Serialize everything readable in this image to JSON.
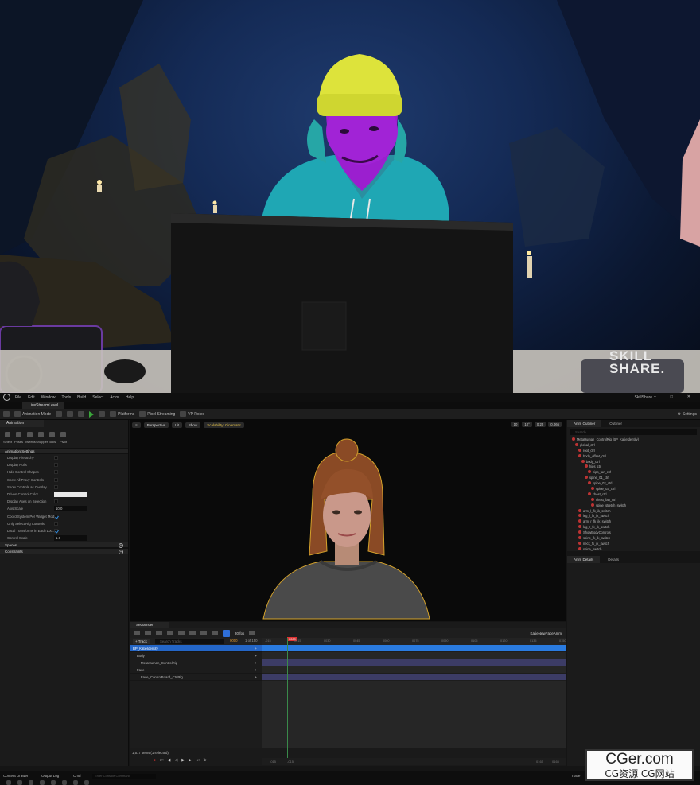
{
  "watermark_top": {
    "line1": "SKILL",
    "line2": "SHARE."
  },
  "editor": {
    "menu": [
      "File",
      "Edit",
      "Window",
      "Tools",
      "Build",
      "Select",
      "Actor",
      "Help"
    ],
    "project_name": "SkillShare",
    "level_tab": "LiveStreamLevel",
    "toolbar": {
      "mode": "Animation Mode",
      "platforms": "Platforms",
      "pixel_streaming": "Pixel Streaming",
      "vp_roles": "VP Roles",
      "settings": "Settings"
    },
    "left_panel": {
      "tab": "Animation",
      "tools": [
        "Select",
        "Poses",
        "Tweens",
        "Snapper",
        "Tools",
        "Pivot"
      ],
      "section_title": "Animation Settings",
      "rows": [
        {
          "label": "Display Hierarchy",
          "type": "check",
          "checked": false
        },
        {
          "label": "Display Nulls",
          "type": "check",
          "checked": false
        },
        {
          "label": "Hide Control Shapes",
          "type": "check",
          "checked": false
        },
        {
          "label": "Show All Proxy Controls",
          "type": "check",
          "checked": false
        },
        {
          "label": "Show Controls as Overlay",
          "type": "check",
          "checked": false
        },
        {
          "label": "Driven Control Color",
          "type": "color"
        },
        {
          "label": "Display Axes on Selection",
          "type": "check",
          "checked": false
        },
        {
          "label": "Axis Scale",
          "type": "value",
          "value": "10.0"
        },
        {
          "label": "Coord System Per Widget Mode",
          "type": "check",
          "checked": true
        },
        {
          "label": "Only Select Rig Controls",
          "type": "check",
          "checked": false
        },
        {
          "label": "Local Transforms in Each Loc...",
          "type": "check",
          "checked": true
        },
        {
          "label": "Control Scale",
          "type": "value",
          "value": "1.0"
        }
      ],
      "sections_after": [
        "Spaces",
        "Constraints"
      ]
    },
    "viewport": {
      "view_mode": "Perspective",
      "lit": "Lit",
      "show": "Show",
      "scalability": "Scalability: Cinematic",
      "right": [
        "10",
        "10°",
        "0.25",
        "0.066"
      ]
    },
    "sequencer": {
      "tab": "Sequencer",
      "fps": "30 fps",
      "sequence_name": "KatieNewFaceAnim",
      "track_button": "+ Track",
      "search_placeholder": "Search Tracks",
      "frame": "0000",
      "frame_count": "1 of 150",
      "playhead": "0000",
      "ticks": [
        "-015",
        "0015",
        "0030",
        "0045",
        "0060",
        "0075",
        "0090",
        "0105",
        "0120",
        "0135",
        "0150"
      ],
      "tracks": [
        {
          "label": "BP_KatieIdentity",
          "indent": 0,
          "selected": true
        },
        {
          "label": "Body",
          "indent": 1,
          "selected": false
        },
        {
          "label": "MetaHuman_ControlRig",
          "indent": 2,
          "selected": false
        },
        {
          "label": "Face",
          "indent": 1,
          "selected": false
        },
        {
          "label": "Face_ControlBoard_CtrlRig",
          "indent": 2,
          "selected": false
        }
      ],
      "status": "1,517 items (1 selected)",
      "foot_left": [
        "-015",
        "-015"
      ],
      "foot_right": [
        "0165",
        "0165"
      ]
    },
    "outliner": {
      "tabs": [
        "Anim Outliner",
        "Outliner"
      ],
      "search_placeholder": "Search...",
      "nodes": [
        {
          "label": "MetaHuman_ControlRig (BP_KatieIdentity)",
          "indent": 0
        },
        {
          "label": "global_ctrl",
          "indent": 1
        },
        {
          "label": "root_ctrl",
          "indent": 2
        },
        {
          "label": "body_offset_ctrl",
          "indent": 2
        },
        {
          "label": "body_ctrl",
          "indent": 3
        },
        {
          "label": "hips_ctrl",
          "indent": 4
        },
        {
          "label": "hips_fan_ctrl",
          "indent": 5
        },
        {
          "label": "spine_01_ctrl",
          "indent": 4
        },
        {
          "label": "spine_02_ctrl",
          "indent": 5
        },
        {
          "label": "spine_03_ctrl",
          "indent": 6
        },
        {
          "label": "chest_ctrl",
          "indent": 5
        },
        {
          "label": "chest_fan_ctrl",
          "indent": 6
        },
        {
          "label": "spine_stretch_switch",
          "indent": 6
        },
        {
          "label": "arm_l_fk_ik_switch",
          "indent": 2
        },
        {
          "label": "leg_l_fk_ik_switch",
          "indent": 2
        },
        {
          "label": "arm_r_fk_ik_switch",
          "indent": 2
        },
        {
          "label": "leg_r_fk_ik_switch",
          "indent": 2
        },
        {
          "label": "ShowBodyControls",
          "indent": 2
        },
        {
          "label": "spine_fk_ik_switch",
          "indent": 2
        },
        {
          "label": "neck_fk_ik_switch",
          "indent": 2
        },
        {
          "label": "spine_switch",
          "indent": 2
        }
      ]
    },
    "details": {
      "tabs": [
        "Anim Details",
        "Details"
      ]
    },
    "bottom": {
      "content_drawer": "Content Drawer",
      "output_log": "Output Log",
      "cmd": "Cmd",
      "cmd_placeholder": "Enter Console Command",
      "trace": "Trace",
      "derived_data": "Derived Data",
      "time": "2:22 PM"
    }
  },
  "cger": {
    "line1": "CGer.com",
    "line2": "CG资源 CG网站"
  }
}
